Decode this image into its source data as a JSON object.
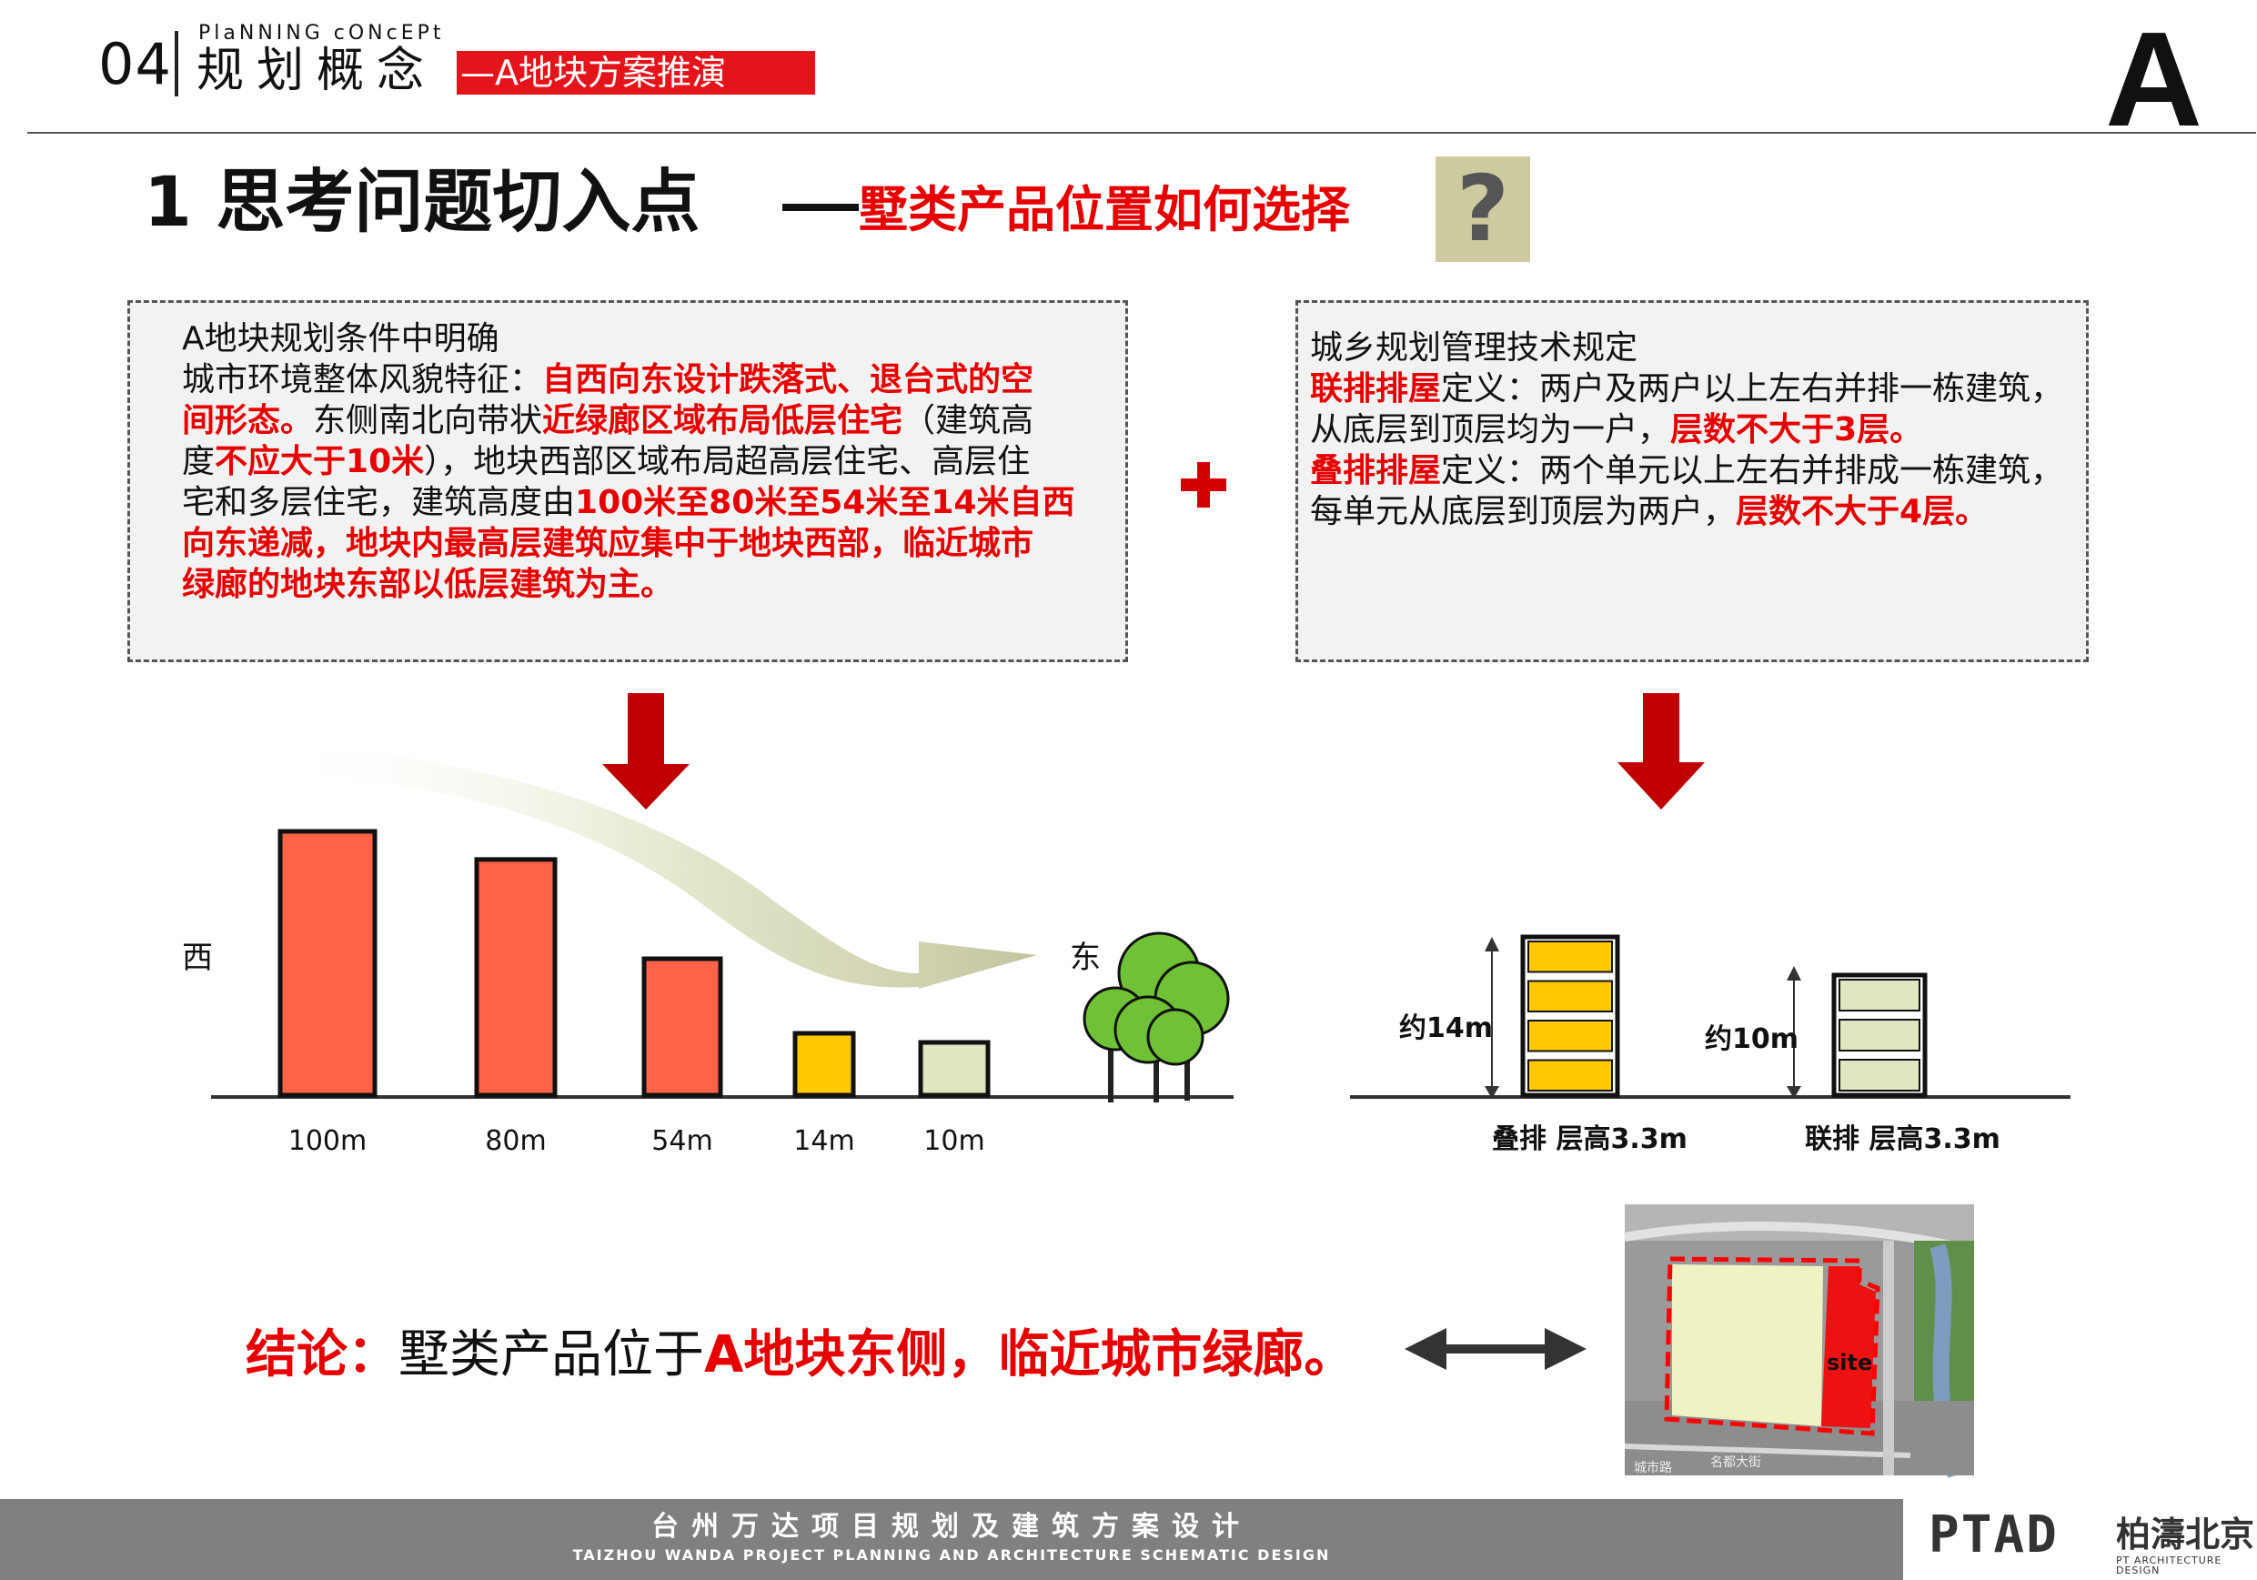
{
  "header": {
    "section_number": "04",
    "section_en": "PlaNNING cONcEPt",
    "section_cn": "规划概念",
    "section_tag": "—A地块方案推演",
    "plot_letter": "A"
  },
  "title": {
    "number_text": "1  思考问题切入点",
    "red_text": "墅类产品位置如何选择",
    "question_mark": "?"
  },
  "left_box": {
    "line1": "A地块规划条件中明确",
    "line2_plain": "城市环境整体风貌特征：",
    "line2_red": "自西向东设计跌落式、退台式的空",
    "line3_red": "间形态。",
    "line3_plain": "东侧南北向带状",
    "line3_red2": "近绿廊区域布局低层住宅",
    "line3_plain2": "（建筑高",
    "line4_plain": "度",
    "line4_red": "不应大于10米",
    "line4_plain2": "），地块西部区域布局超高层住宅、高层住",
    "line5_plain": "宅和多层住宅，建筑高度由",
    "line5_red": "100米至80米至54米至14米自西",
    "line6_red": "向东递减，",
    "line6_red2": "地块内最高层建筑应集中于地块西部，临近城市",
    "line7_red": "绿廊的地块东部以低层建筑为主。"
  },
  "right_box": {
    "line1": "城乡规划管理技术规定",
    "line2_red": "联排排屋",
    "line2_plain": "定义：两户及两户以上左右并排一栋建筑，",
    "line3_plain": "从底层到顶层均为一户，",
    "line3_red": "层数不大于3层。",
    "line4_red": "叠排排屋",
    "line4_plain": "定义：两个单元以上左右并排成一栋建筑，",
    "line5_plain": "每单元从底层到顶层为两户，",
    "line5_red": "层数不大于4层。"
  },
  "height_diagram": {
    "west_label": "西",
    "east_label": "东",
    "buildings": [
      {
        "label": "100m",
        "height": 100,
        "color": "#ff6347"
      },
      {
        "label": "80m",
        "height": 80,
        "color": "#ff6347"
      },
      {
        "label": "54m",
        "height": 54,
        "color": "#ff6347"
      },
      {
        "label": "14m",
        "height": 14,
        "color": "#ffc800"
      },
      {
        "label": "10m",
        "height": 10,
        "color": "#e1e6c0"
      }
    ]
  },
  "townhouse_diagram": {
    "stacked": {
      "height_label": "约14m",
      "caption": "叠排 层高3.3m",
      "floors": 4,
      "color": "#ffc800"
    },
    "row": {
      "height_label": "约10m",
      "caption": "联排  层高3.3m",
      "floors": 3,
      "color": "#e1e6c0"
    }
  },
  "site_map": {
    "site_label": "site",
    "road_label_1": "城市路",
    "road_label_2": "名都大街"
  },
  "conclusion": {
    "red1": "结论：",
    "plain": "墅类产品位于",
    "red2": "A地块东侧，临近城市绿廊。"
  },
  "footer": {
    "cn": "台州万达项目规划及建筑方案设计",
    "en": "TAIZHOU  WANDA    PROJECT  PLANNING  AND  ARCHITECTURE  SCHEMATIC  DESIGN",
    "logo_main": "PTAD",
    "logo_cn": "柏濤北京",
    "logo_sub": "PT ARCHITECTURE DESIGN"
  },
  "colors": {
    "accent_red": "#e60000",
    "arrow_red": "#c00000",
    "tall_building": "#ff6347",
    "mid_building": "#ffc800",
    "low_building": "#e1e6c0"
  }
}
